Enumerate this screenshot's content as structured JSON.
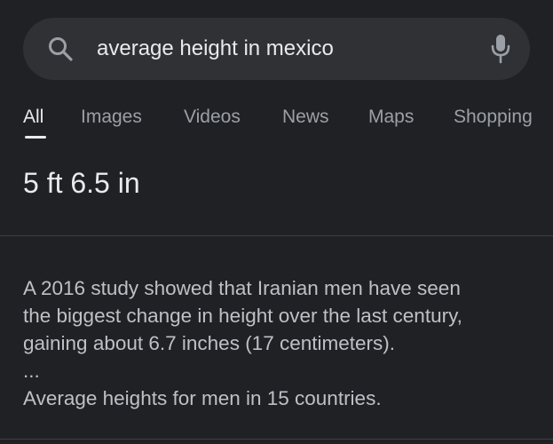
{
  "search": {
    "query": "average height in mexico",
    "search_icon": "search-icon",
    "mic_icon": "microphone-icon"
  },
  "tabs": [
    {
      "label": "All",
      "active": true
    },
    {
      "label": "Images",
      "active": false
    },
    {
      "label": "Videos",
      "active": false
    },
    {
      "label": "News",
      "active": false
    },
    {
      "label": "Maps",
      "active": false
    },
    {
      "label": "Shopping",
      "active": false
    }
  ],
  "answer": {
    "value": "5 ft 6.5 in"
  },
  "snippet": {
    "lines": [
      "A 2016 study showed that Iranian men have seen",
      "the biggest change in height over the last century,",
      "gaining about 6.7 inches (17 centimeters).",
      "...",
      "Average heights for men in 15 countries."
    ]
  },
  "colors": {
    "background": "#202124",
    "search_bar": "#303134",
    "text_primary": "#e8eaed",
    "text_secondary": "#9aa0a6"
  }
}
